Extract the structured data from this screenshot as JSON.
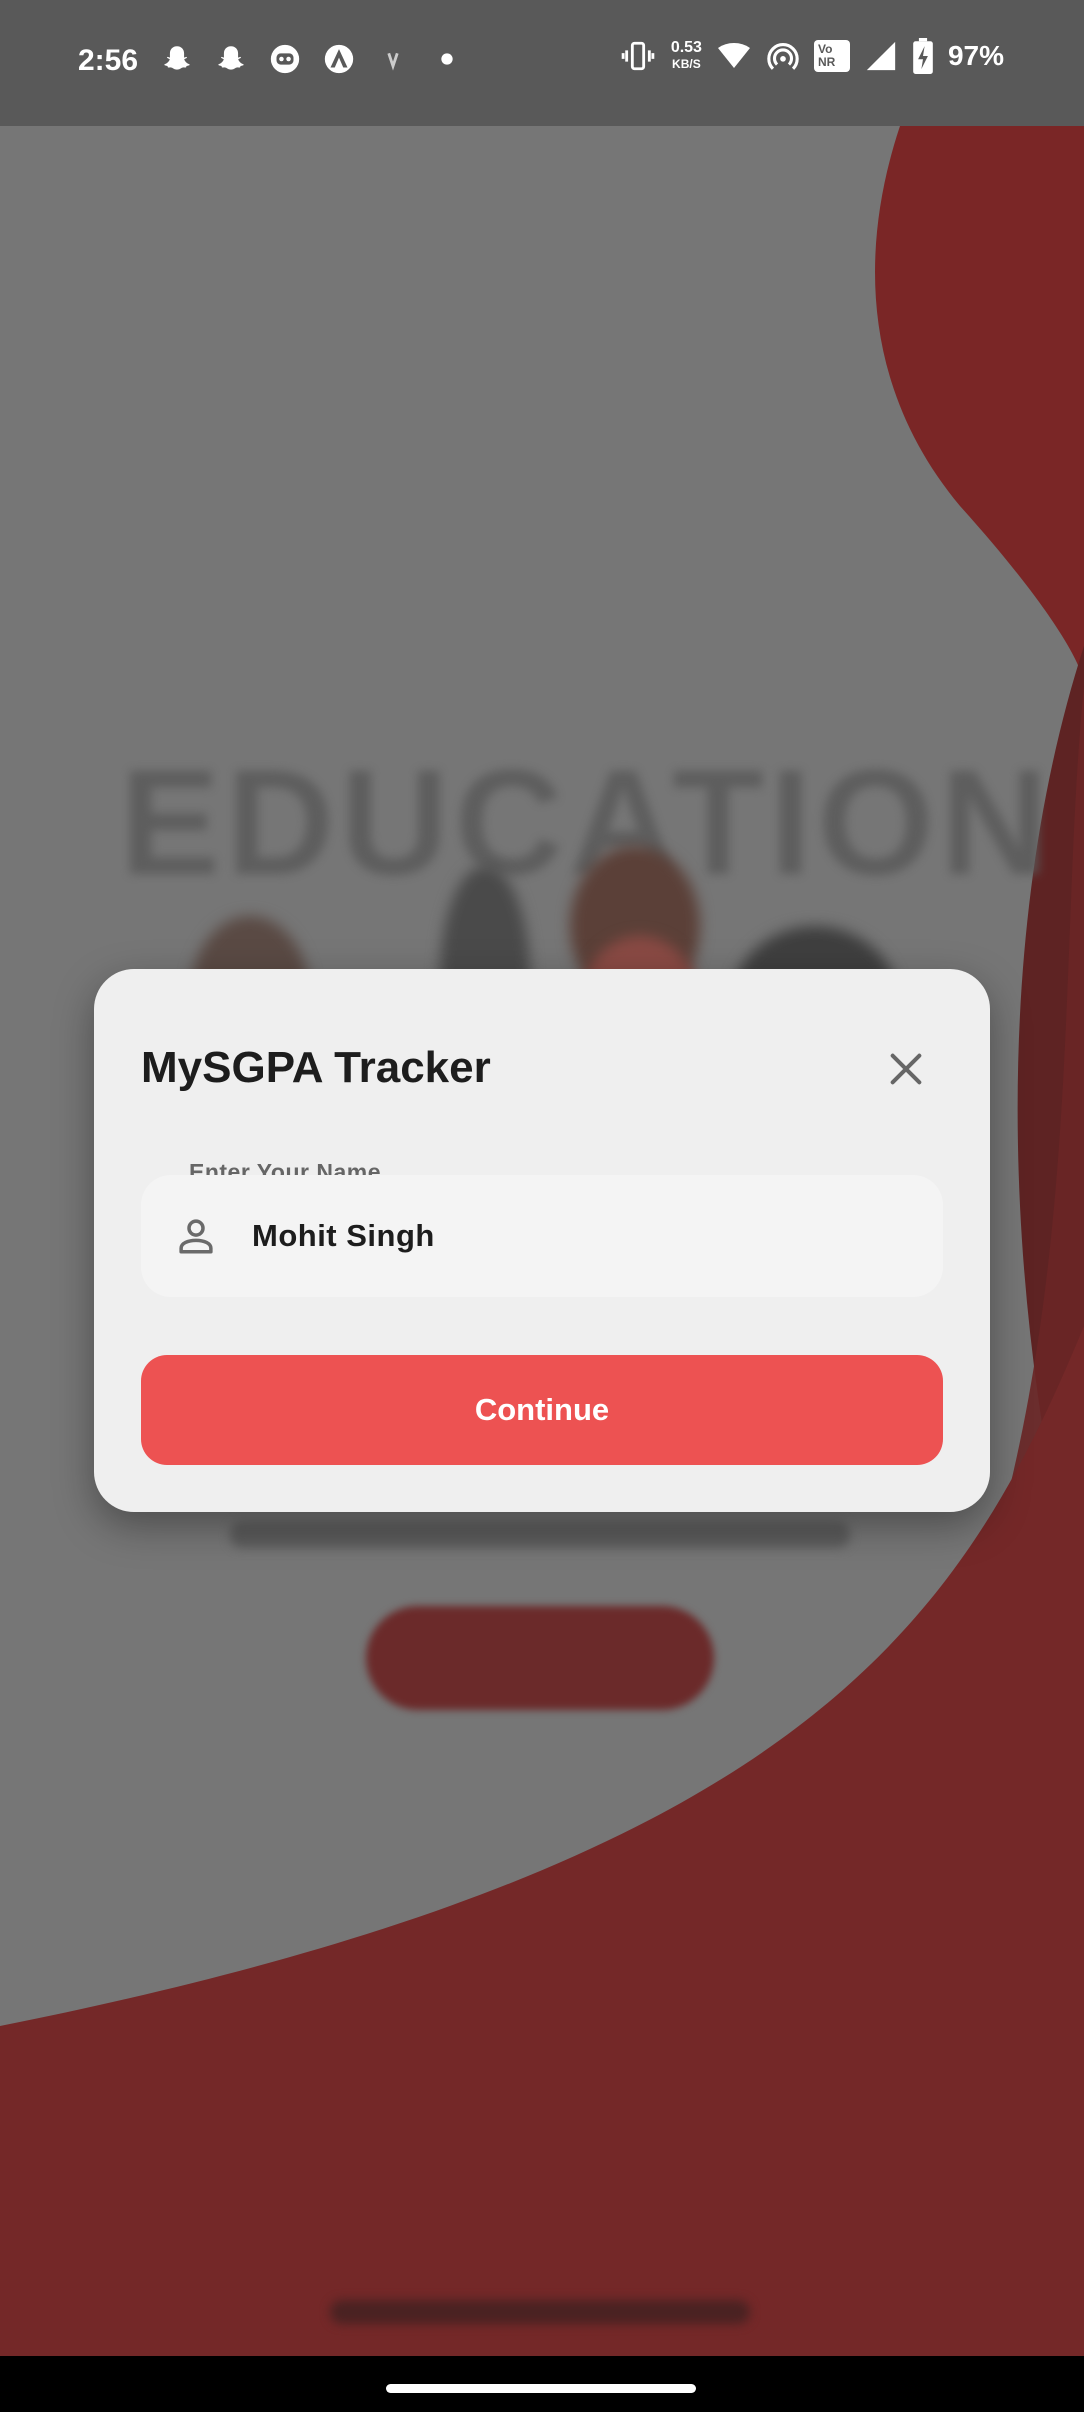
{
  "status_bar": {
    "time": "2:56",
    "left_icons": [
      "snapchat-icon",
      "snapchat-icon",
      "app-icon",
      "app-icon",
      "app-icon",
      "dot-icon"
    ],
    "net_speed_value": "0.53",
    "net_speed_unit": "KB/S",
    "vonr_top": "Vo",
    "vonr_bottom": "NR",
    "battery_percent": "97%"
  },
  "dialog": {
    "title": "MySGPA Tracker",
    "close_icon": "close-icon",
    "name_field": {
      "label": "Enter Your Name",
      "value": "Mohit Singh",
      "icon": "person-icon"
    },
    "continue_label": "Continue"
  },
  "colors": {
    "accent": "#ED5252",
    "dialog_bg": "#EFEFEF",
    "background_red": "#7A2626"
  }
}
